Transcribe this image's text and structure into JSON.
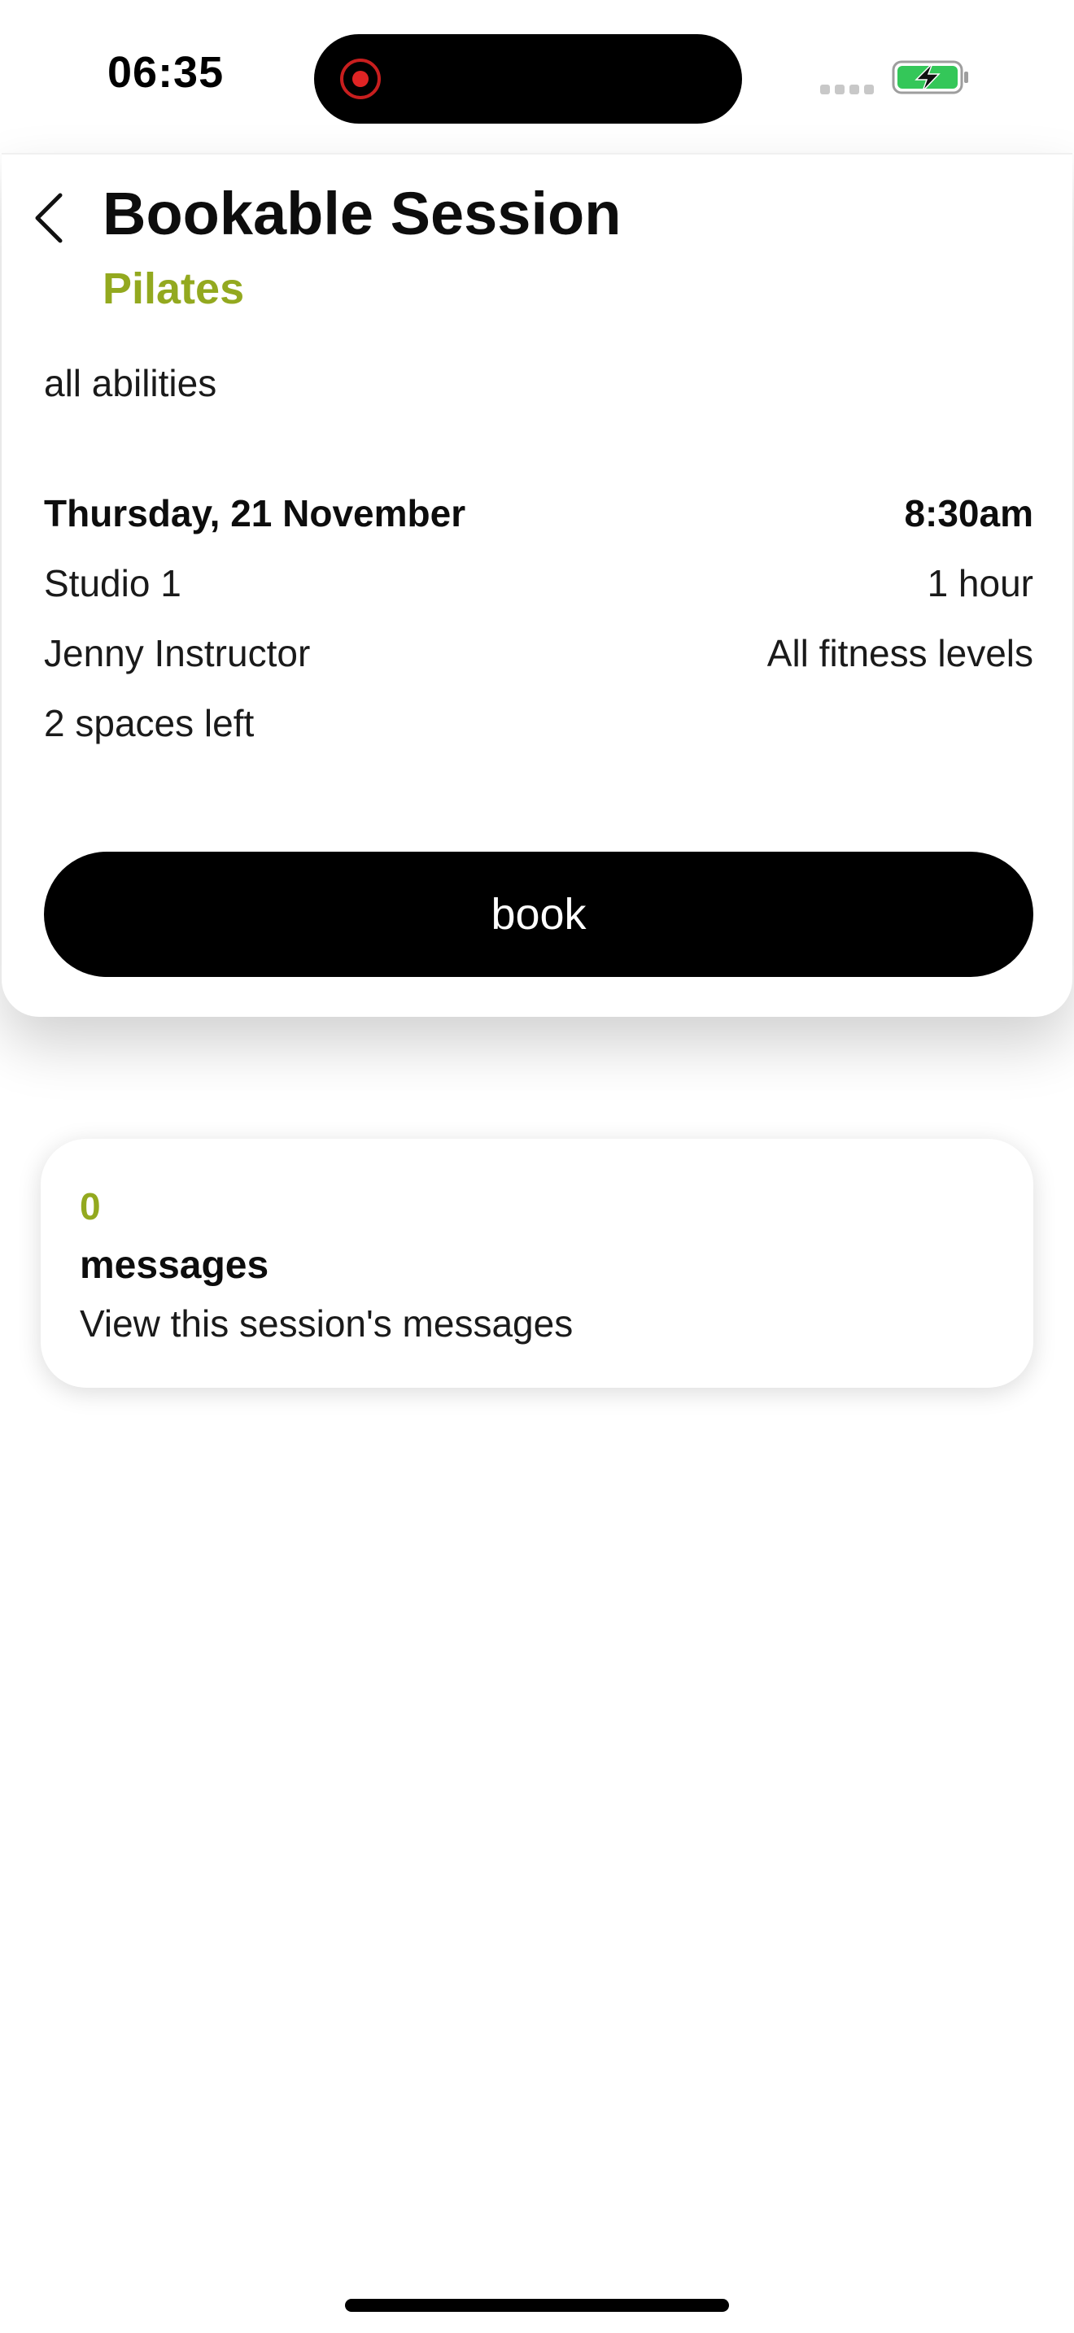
{
  "status_bar": {
    "time": "06:35"
  },
  "header": {
    "title": "Bookable Session",
    "subtitle": "Pilates"
  },
  "session": {
    "description": "all abilities",
    "date": "Thursday, 21 November",
    "time": "8:30am",
    "location": "Studio 1",
    "duration": "1 hour",
    "instructor": "Jenny Instructor",
    "level": "All fitness levels",
    "spaces": "2 spaces left"
  },
  "actions": {
    "book_label": "book"
  },
  "messages": {
    "count": "0",
    "label": "messages",
    "link_text": "View this session's messages"
  },
  "colors": {
    "accent": "#93a91f",
    "button": "#000000",
    "battery": "#34c759"
  },
  "icons": {
    "back": "chevron-left-icon",
    "recording": "record-icon",
    "signal": "cellular-signal-icon",
    "battery": "battery-charging-icon"
  }
}
